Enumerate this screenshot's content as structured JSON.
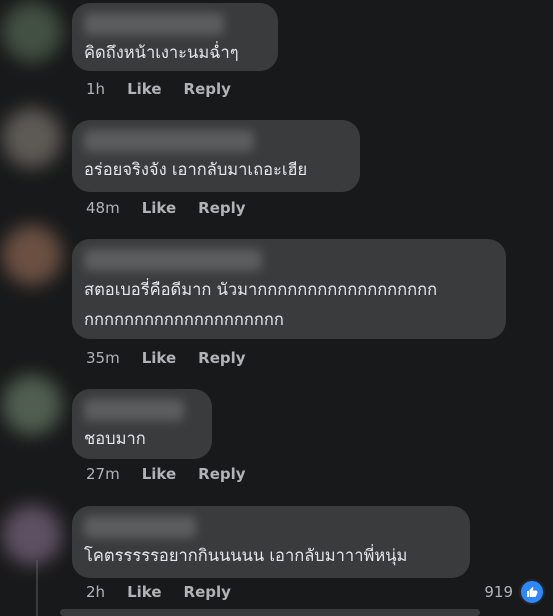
{
  "comments": [
    {
      "text": "คิดถึงหน้าเงาะนมฉ่ำๆ",
      "time": "1h",
      "like_label": "Like",
      "reply_label": "Reply",
      "avatar_color": "#4a5a4a"
    },
    {
      "text": "อร่อยจริงจัง เอากลับมาเถอะเฮีย",
      "time": "48m",
      "like_label": "Like",
      "reply_label": "Reply",
      "avatar_color": "#6a6660"
    },
    {
      "text": "สตอเบอรี่คือดีมาก นัวมากกกกกกกกกกกกกกกกกก\nกกกกกกกกกกกกกกกกกกกก",
      "time": "35m",
      "like_label": "Like",
      "reply_label": "Reply",
      "avatar_color": "#7a5a4a"
    },
    {
      "text": "ชอบมาก",
      "time": "27m",
      "like_label": "Like",
      "reply_label": "Reply",
      "avatar_color": "#5a6a5a"
    },
    {
      "text": "โคตรรรรรอยากกินนนนน เอากลับมาาาพี่หนุ่ม",
      "time": "2h",
      "like_label": "Like",
      "reply_label": "Reply",
      "avatar_color": "#6a5a70",
      "reaction_count": "919",
      "reaction_icon": "thumbs-up-icon"
    }
  ],
  "colors": {
    "background": "#18191a",
    "bubble": "#3a3b3c",
    "secondary_text": "#b0b3b8",
    "like_blue": "#2d88ff"
  }
}
